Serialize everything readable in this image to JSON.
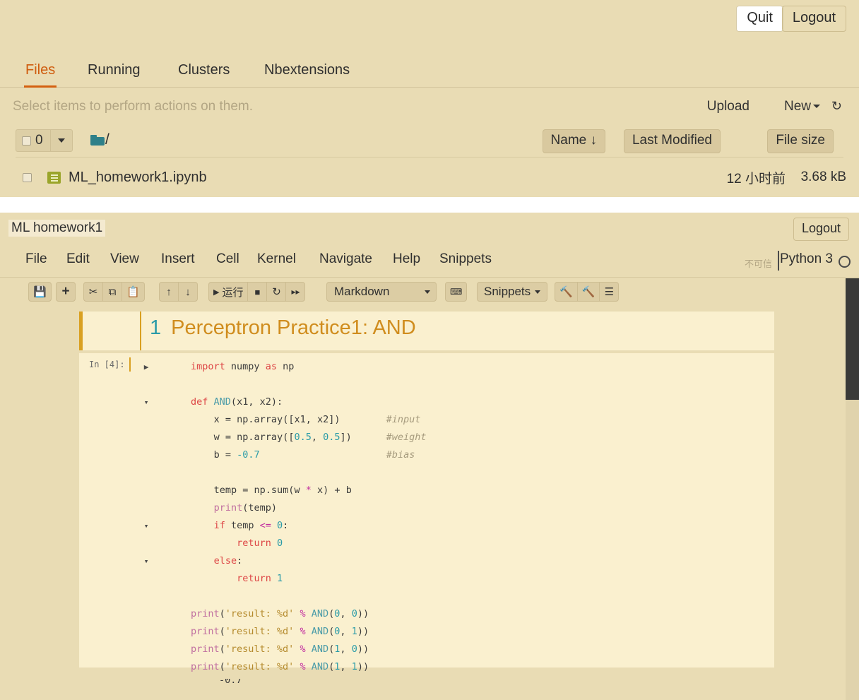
{
  "tree": {
    "quit_label": "Quit",
    "logout_label": "Logout",
    "tabs": [
      {
        "label": "Files",
        "active": true
      },
      {
        "label": "Running",
        "active": false
      },
      {
        "label": "Clusters",
        "active": false
      },
      {
        "label": "Nbextensions",
        "active": false
      }
    ],
    "select_note": "Select items to perform actions on them.",
    "upload_label": "Upload",
    "new_label": "New",
    "refresh_icon": "refresh-icon",
    "selected_count": "0",
    "breadcrumb_root": "/",
    "sort_name": "Name",
    "sort_name_arrow": "↓",
    "sort_modified": "Last Modified",
    "sort_filesize": "File size",
    "files": [
      {
        "name": "ML_homework1.ipynb",
        "modified": "12 小时前",
        "size": "3.68 kB",
        "icon": "notebook-icon"
      }
    ]
  },
  "notebook": {
    "title": "ML homework1",
    "logout_label": "Logout",
    "menu": [
      "File",
      "Edit",
      "View",
      "Insert",
      "Cell",
      "Kernel",
      "Navigate",
      "Help",
      "Snippets"
    ],
    "trust_label": "不可信",
    "kernel_name": "Python 3",
    "kernel_status_icon": "circle-idle-icon",
    "toolbar": {
      "save_icon": "save-icon",
      "add_icon": "plus-icon",
      "cut_icon": "scissors-icon",
      "copy_icon": "copy-icon",
      "paste_icon": "paste-icon",
      "up_icon": "arrow-up-icon",
      "down_icon": "arrow-down-icon",
      "run_label": "运行",
      "run_icon": "play-icon",
      "stop_icon": "stop-square-icon",
      "restart_icon": "restart-icon",
      "runall_icon": "fast-forward-icon",
      "celltype_value": "Markdown",
      "keyboard_icon": "keyboard-icon",
      "snippets_label": "Snippets",
      "hammer1_icon": "hammer-icon",
      "hammer2_icon": "hammer-icon",
      "toc_icon": "list-icon"
    },
    "cells": [
      {
        "type": "markdown_heading",
        "number": "1",
        "text": "Perceptron Practice1: AND",
        "selected": true
      },
      {
        "type": "code",
        "prompt": "In [4]:",
        "lines": [
          {
            "gutter": "▶",
            "code": "import numpy as np"
          },
          {
            "gutter": "",
            "code": ""
          },
          {
            "gutter": "▾",
            "code": "def AND(x1, x2):"
          },
          {
            "gutter": "",
            "code": "    x = np.array([x1, x2])        #input"
          },
          {
            "gutter": "",
            "code": "    w = np.array([0.5, 0.5])      #weight"
          },
          {
            "gutter": "",
            "code": "    b = -0.7                      #bias"
          },
          {
            "gutter": "",
            "code": ""
          },
          {
            "gutter": "",
            "code": "    temp = np.sum(w * x) + b"
          },
          {
            "gutter": "",
            "code": "    print(temp)"
          },
          {
            "gutter": "▾",
            "code": "    if temp <= 0:"
          },
          {
            "gutter": "",
            "code": "        return 0"
          },
          {
            "gutter": "▾",
            "code": "    else:"
          },
          {
            "gutter": "",
            "code": "        return 1"
          },
          {
            "gutter": "",
            "code": ""
          },
          {
            "gutter": "",
            "code": "print('result: %d' % AND(0, 0))"
          },
          {
            "gutter": "",
            "code": "print('result: %d' % AND(0, 1))"
          },
          {
            "gutter": "",
            "code": "print('result: %d' % AND(1, 0))"
          },
          {
            "gutter": "",
            "code": "print('result: %d' % AND(1, 1))"
          }
        ],
        "output_partial": "-0.7"
      }
    ]
  }
}
